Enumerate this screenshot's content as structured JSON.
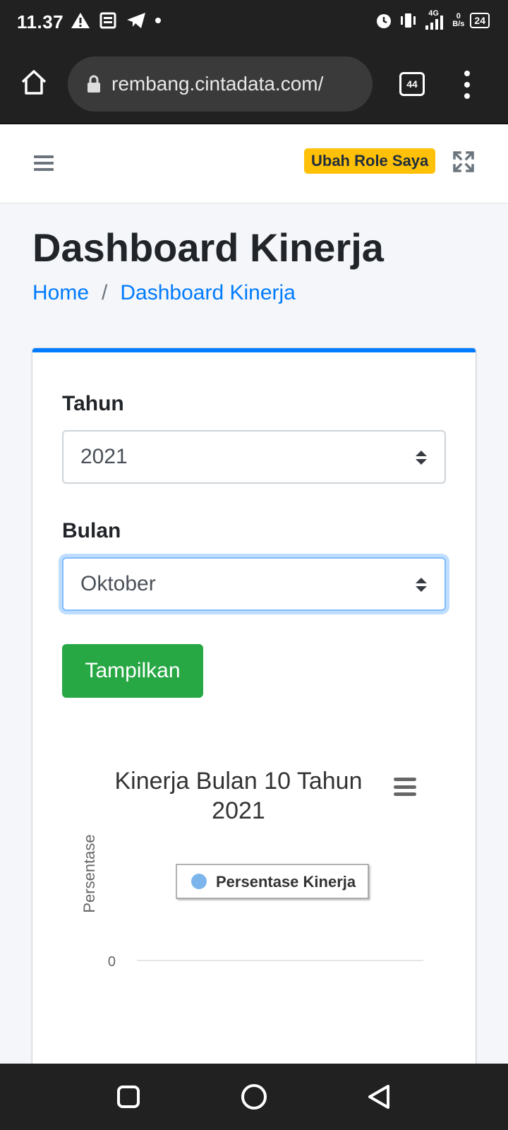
{
  "statusbar": {
    "time": "11.37",
    "net_speed": "0",
    "net_unit": "B/s",
    "signal": "4G",
    "battery": "24"
  },
  "browser": {
    "url": "rembang.cintadata.com/",
    "tab_count": "44"
  },
  "navbar": {
    "role_button": "Ubah Role Saya"
  },
  "page": {
    "title": "Dashboard Kinerja"
  },
  "breadcrumb": {
    "home": "Home",
    "separator": "/",
    "current": "Dashboard Kinerja"
  },
  "form": {
    "year_label": "Tahun",
    "year_value": "2021",
    "month_label": "Bulan",
    "month_value": "Oktober",
    "submit_label": "Tampilkan"
  },
  "chart_data": {
    "type": "bar",
    "title": "Kinerja Bulan 10 Tahun 2021",
    "ylabel": "Persentase",
    "xlabel": "",
    "yticks": [
      "0"
    ],
    "series": [
      {
        "name": "Persentase Kinerja",
        "color": "#7cb5ec"
      }
    ],
    "categories": [],
    "values": [],
    "legend": "top-center"
  },
  "colors": {
    "primary": "#007bff",
    "success": "#28a745",
    "warning": "#ffc107"
  }
}
